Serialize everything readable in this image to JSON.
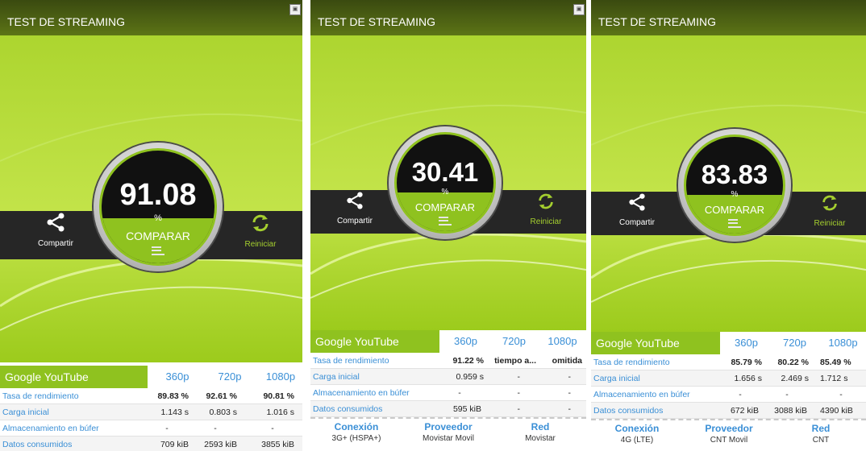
{
  "app_title": "TEST DE STREAMING",
  "labels": {
    "share": "Compartir",
    "restart": "Reiniciar",
    "compare": "COMPARAR",
    "percent": "%",
    "service": "Google YouTube"
  },
  "columns": [
    "360p",
    "720p",
    "1080p"
  ],
  "row_labels": [
    "Tasa de rendimiento",
    "Carga inicial",
    "Almacenamiento en búfer",
    "Datos consumidos"
  ],
  "footer_headers": {
    "connection": "Conexión",
    "provider": "Proveedor",
    "network": "Red"
  },
  "panels": [
    {
      "score": "91.08",
      "rows": [
        [
          "89.83 %",
          "92.61 %",
          "90.81 %"
        ],
        [
          "1.143 s",
          "0.803 s",
          "1.016 s"
        ],
        [
          "-",
          "-",
          "-"
        ],
        [
          "709 kiB",
          "2593 kiB",
          "3855 kiB"
        ]
      ],
      "footer": null
    },
    {
      "score": "30.41",
      "rows": [
        [
          "91.22 %",
          "tiempo a...",
          "omitida"
        ],
        [
          "0.959 s",
          "-",
          "-"
        ],
        [
          "-",
          "-",
          "-"
        ],
        [
          "595 kiB",
          "-",
          "-"
        ]
      ],
      "footer": {
        "connection": "3G+ (HSPA+)",
        "provider": "Movistar Movil",
        "network": "Movistar"
      }
    },
    {
      "score": "83.83",
      "rows": [
        [
          "85.79 %",
          "80.22 %",
          "85.49 %"
        ],
        [
          "1.656 s",
          "2.469 s",
          "1.712 s"
        ],
        [
          "-",
          "-",
          "-"
        ],
        [
          "672 kiB",
          "3088 kiB",
          "4390 kiB"
        ]
      ],
      "footer": {
        "connection": "4G (LTE)",
        "provider": "CNT Movil",
        "network": "CNT"
      }
    }
  ]
}
